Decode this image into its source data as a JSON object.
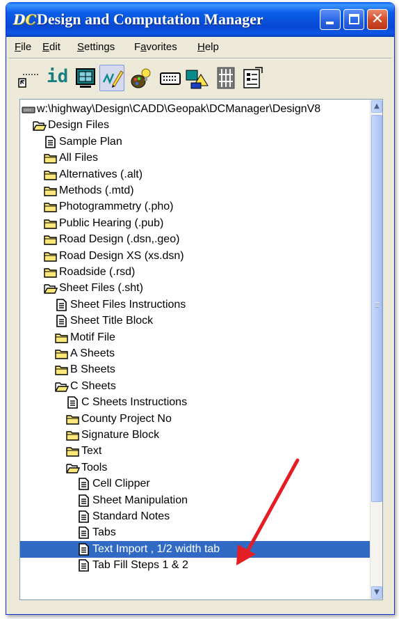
{
  "window": {
    "title": "Design and Computation Manager",
    "icon_text": "D",
    "icon_sub": "C"
  },
  "menu": {
    "file": {
      "accel": "F",
      "rest": "ile"
    },
    "edit": {
      "accel": "E",
      "rest": "dit"
    },
    "settings": {
      "accel": "S",
      "rest": "ettings"
    },
    "favorites": {
      "pre": "F",
      "accel": "a",
      "rest": "vorites"
    },
    "help": {
      "accel": "H",
      "rest": "elp"
    }
  },
  "toolbar": {
    "id_label": "id",
    "tools": [
      "element-placer-icon",
      "id-icon",
      "display-icon",
      "draw-icon",
      "palette-icon",
      "keyboard-icon",
      "shapes-icon",
      "grid-icon",
      "properties-icon"
    ]
  },
  "tree": {
    "rows": [
      {
        "text": "w:\\highway\\Design\\CADD\\Geopak\\DCManager\\DesignV8",
        "icon": "drive",
        "level": 0
      },
      {
        "text": "Design Files",
        "icon": "folder-open",
        "level": 1
      },
      {
        "text": "Sample Plan",
        "icon": "doc",
        "level": 2
      },
      {
        "text": "All Files",
        "icon": "folder",
        "level": 2
      },
      {
        "text": "Alternatives (.alt)",
        "icon": "folder",
        "level": 2
      },
      {
        "text": "Methods (.mtd)",
        "icon": "folder",
        "level": 2
      },
      {
        "text": "Photogrammetry (.pho)",
        "icon": "folder",
        "level": 2
      },
      {
        "text": "Public Hearing (.pub)",
        "icon": "folder",
        "level": 2
      },
      {
        "text": "Road Design (.dsn,.geo)",
        "icon": "folder",
        "level": 2
      },
      {
        "text": "Road Design XS (xs.dsn)",
        "icon": "folder",
        "level": 2
      },
      {
        "text": "Roadside (.rsd)",
        "icon": "folder",
        "level": 2
      },
      {
        "text": "Sheet Files (.sht)",
        "icon": "folder-open",
        "level": 2
      },
      {
        "text": "Sheet Files Instructions",
        "icon": "doc",
        "level": 3
      },
      {
        "text": "Sheet Title Block",
        "icon": "doc",
        "level": 3
      },
      {
        "text": "Motif File",
        "icon": "folder",
        "level": 3
      },
      {
        "text": "A Sheets",
        "icon": "folder",
        "level": 3
      },
      {
        "text": "B Sheets",
        "icon": "folder",
        "level": 3
      },
      {
        "text": "C Sheets",
        "icon": "folder-open",
        "level": 3
      },
      {
        "text": "C Sheets Instructions",
        "icon": "doc",
        "level": 4
      },
      {
        "text": "County Project No",
        "icon": "folder",
        "level": 4
      },
      {
        "text": "Signature Block",
        "icon": "folder",
        "level": 4
      },
      {
        "text": "Text",
        "icon": "folder",
        "level": 4
      },
      {
        "text": "Tools",
        "icon": "folder-open",
        "level": 4
      },
      {
        "text": "Cell Clipper",
        "icon": "doc",
        "level": 5
      },
      {
        "text": "Sheet Manipulation",
        "icon": "doc",
        "level": 5
      },
      {
        "text": "Standard Notes",
        "icon": "doc",
        "level": 5
      },
      {
        "text": "Tabs",
        "icon": "doc",
        "level": 5
      },
      {
        "text": "Text Import , 1/2 width tab",
        "icon": "doc",
        "level": 5,
        "selected": true
      },
      {
        "text": "Tab Fill Steps 1 & 2",
        "icon": "doc",
        "level": 5
      }
    ]
  },
  "colors": {
    "selection": "#316ac5",
    "folder": "#ffe87a",
    "annotation_arrow": "#e31e24"
  }
}
